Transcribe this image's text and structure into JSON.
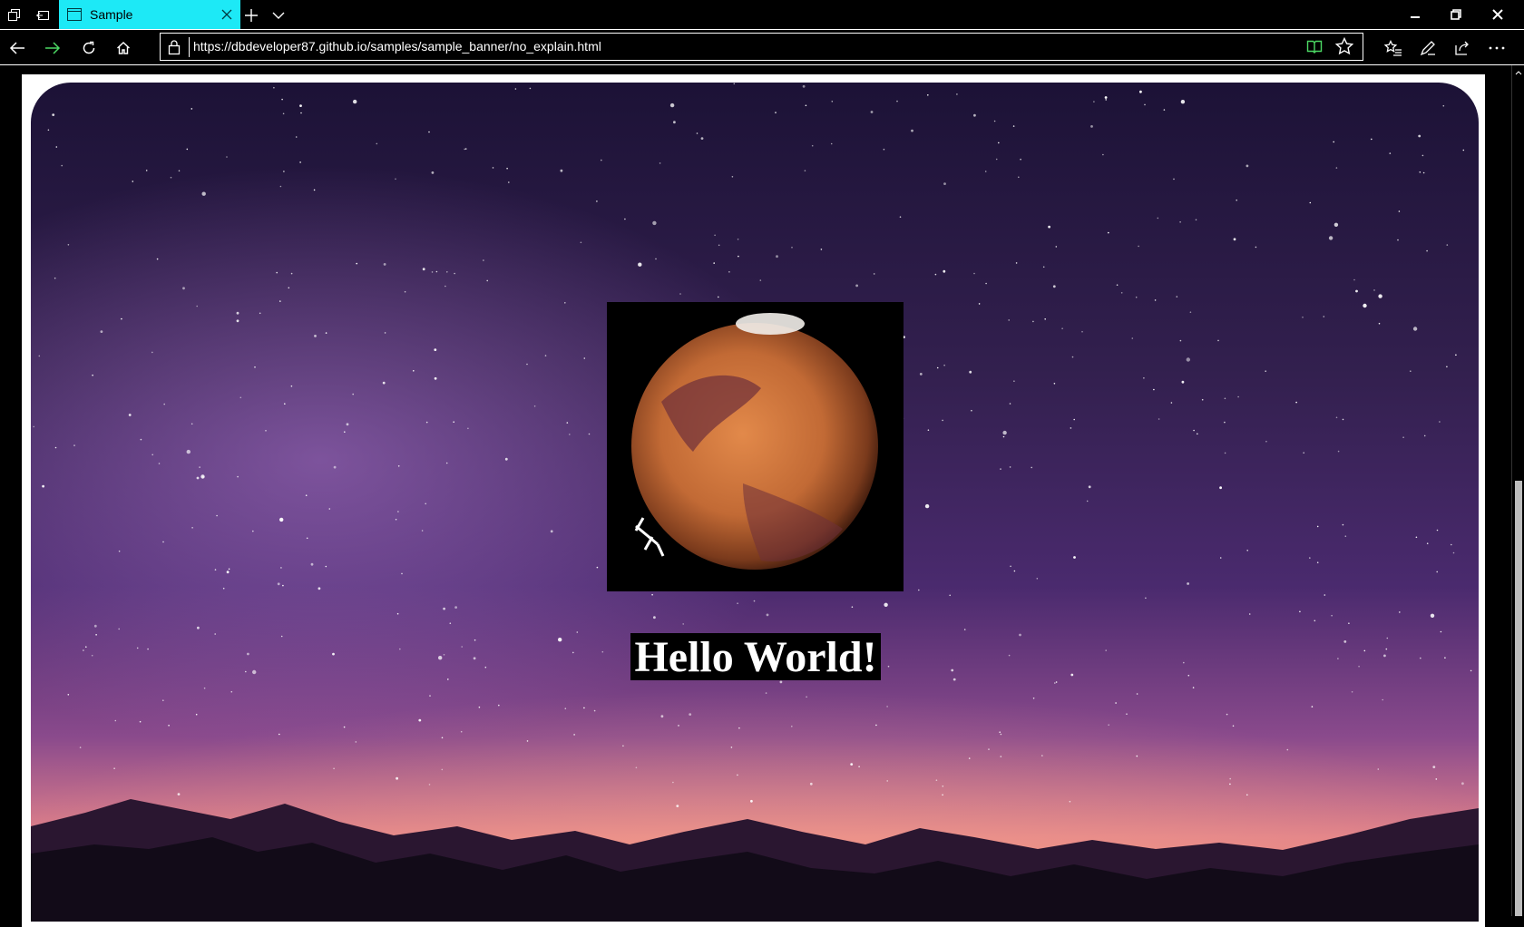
{
  "browser": {
    "tab": {
      "title": "Sample"
    },
    "address_bar": {
      "url": "https://dbdeveloper87.github.io/samples/sample_banner/no_explain.html"
    },
    "icons": {
      "tab_actions": "tab-actions-icon",
      "set_aside": "set-aside-tabs-icon",
      "new_tab": "plus-icon",
      "tab_list": "chevron-down-icon",
      "minimize": "minimize-icon",
      "restore": "restore-icon",
      "close": "close-icon",
      "back": "arrow-left-icon",
      "forward": "arrow-right-icon",
      "refresh": "refresh-icon",
      "home": "home-icon",
      "lock": "lock-icon",
      "reading_view": "book-icon",
      "favorite": "star-icon",
      "favorites_hub": "favorites-list-icon",
      "notes": "pen-icon",
      "share": "share-icon",
      "more": "ellipsis-icon"
    },
    "colors": {
      "tab_active": "#1de9f6",
      "forward_arrow": "#4cd964",
      "reading_view": "#4cd964"
    }
  },
  "page": {
    "heading": "Hello World!",
    "colors": {
      "sky_top": "#1c1236",
      "sky_mid": "#4a2a6e",
      "horizon": "#f08a6b",
      "mountains": "#120b18"
    }
  }
}
